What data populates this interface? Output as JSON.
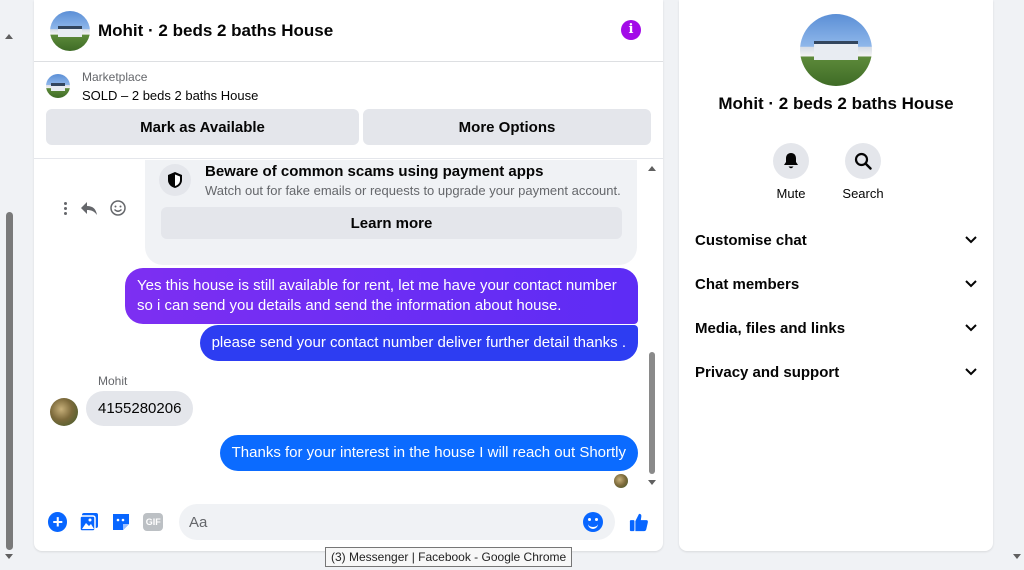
{
  "chat": {
    "title": "Mohit · 2 beds 2 baths House",
    "info_icon_glyph": "i"
  },
  "marketplace": {
    "label": "Marketplace",
    "item": "SOLD – 2 beds 2 baths House",
    "mark_available": "Mark as Available",
    "more_options": "More Options"
  },
  "scam_notice": {
    "title": "Beware of common scams using payment apps",
    "subtitle": "Watch out for fake emails or requests to upgrade your payment account.",
    "learn_more": "Learn more"
  },
  "messages": [
    {
      "direction": "out",
      "text": "Yes this house is still available for rent, let me have your contact number so i can send you details and send the information about house."
    },
    {
      "direction": "out",
      "text": "please send your contact number deliver further detail thanks ."
    },
    {
      "direction": "in",
      "sender": "Mohit",
      "text": "4155280206"
    },
    {
      "direction": "out",
      "text": "Thanks for your interest in the house I will reach out Shortly"
    }
  ],
  "composer": {
    "placeholder": "Aa",
    "gif_label": "GIF"
  },
  "info_panel": {
    "title": "Mohit · 2 beds 2 baths House",
    "actions": [
      {
        "label": "Mute",
        "icon": "bell-icon"
      },
      {
        "label": "Search",
        "icon": "search-icon"
      }
    ],
    "sections": [
      {
        "label": "Customise chat"
      },
      {
        "label": "Chat members"
      },
      {
        "label": "Media, files and links"
      },
      {
        "label": "Privacy and support"
      }
    ]
  },
  "tooltip": "(3) Messenger | Facebook - Google Chrome",
  "colors": {
    "accent": "#0866ff",
    "info": "#a30ae8",
    "bubble_purple": "#7d2ff2",
    "bubble_blue": "#0b6bff"
  }
}
